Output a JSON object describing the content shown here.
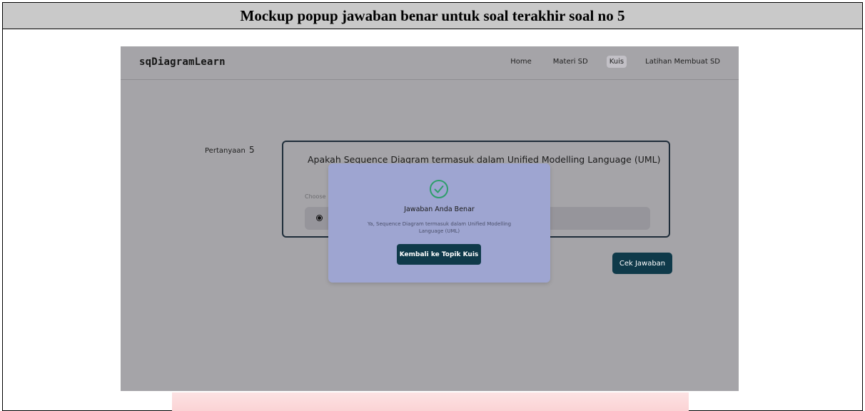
{
  "caption": "Mockup popup jawaban benar untuk soal terakhir soal no 5",
  "navbar": {
    "brand": "sqDiagramLearn",
    "links": [
      {
        "label": "Home",
        "active": false
      },
      {
        "label": "Materi SD",
        "active": false
      },
      {
        "label": "Kuis",
        "active": true
      },
      {
        "label": "Latihan Membuat SD",
        "active": false
      }
    ]
  },
  "question": {
    "label": "Pertanyaan",
    "number": "5",
    "text": "Apakah Sequence Diagram termasuk dalam Unified Modelling Language (UML)",
    "choose_text": "Choose"
  },
  "check_button": "Cek Jawaban",
  "popup": {
    "icon": "check-circle-icon",
    "title": "Jawaban Anda Benar",
    "message": "Ya, Sequence Diagram termasuk dalam Unified Modelling Language (UML)",
    "button": "Kembali ke Topik Kuis"
  },
  "colors": {
    "overlay": "#a5a4a8",
    "popup_bg": "#9ea5d1",
    "button_bg": "#0f3a4a",
    "success": "#2e9e6b",
    "caption_bg": "#c9c9c9"
  }
}
